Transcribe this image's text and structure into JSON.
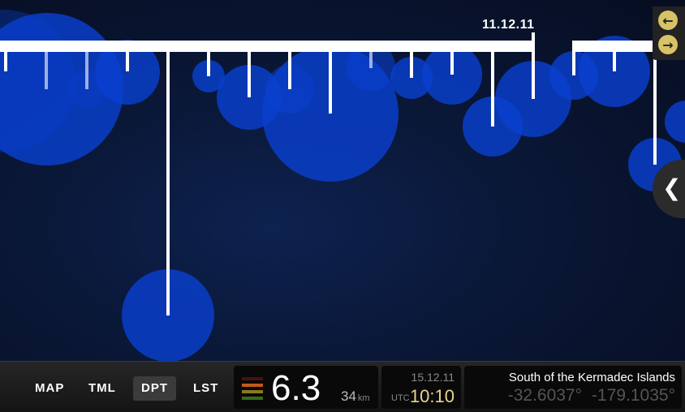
{
  "timeline": {
    "date_label": "11.12.11"
  },
  "controls": {
    "prev_glyph": "←",
    "next_glyph": "→",
    "collapse_glyph": "❮"
  },
  "bottom_nav": {
    "items": [
      {
        "label": "MAP",
        "active": false
      },
      {
        "label": "TML",
        "active": false
      },
      {
        "label": "DPT",
        "active": true
      },
      {
        "label": "LST",
        "active": false
      }
    ]
  },
  "quake": {
    "magnitude": "6.3",
    "depth_value": "34",
    "depth_unit": "km",
    "date": "15.12.11",
    "utc_label": "UTC",
    "time": "10:10",
    "location": "South of the Kermadec Islands",
    "latitude": "-32.6037°",
    "longitude": "-179.1035°",
    "magnitude_colors": [
      "#4a1010",
      "#c05a1a",
      "#8a7a1a",
      "#3a6a18"
    ]
  },
  "colors": {
    "bubble": "#0a3fd0",
    "accent": "#d7c267"
  }
}
